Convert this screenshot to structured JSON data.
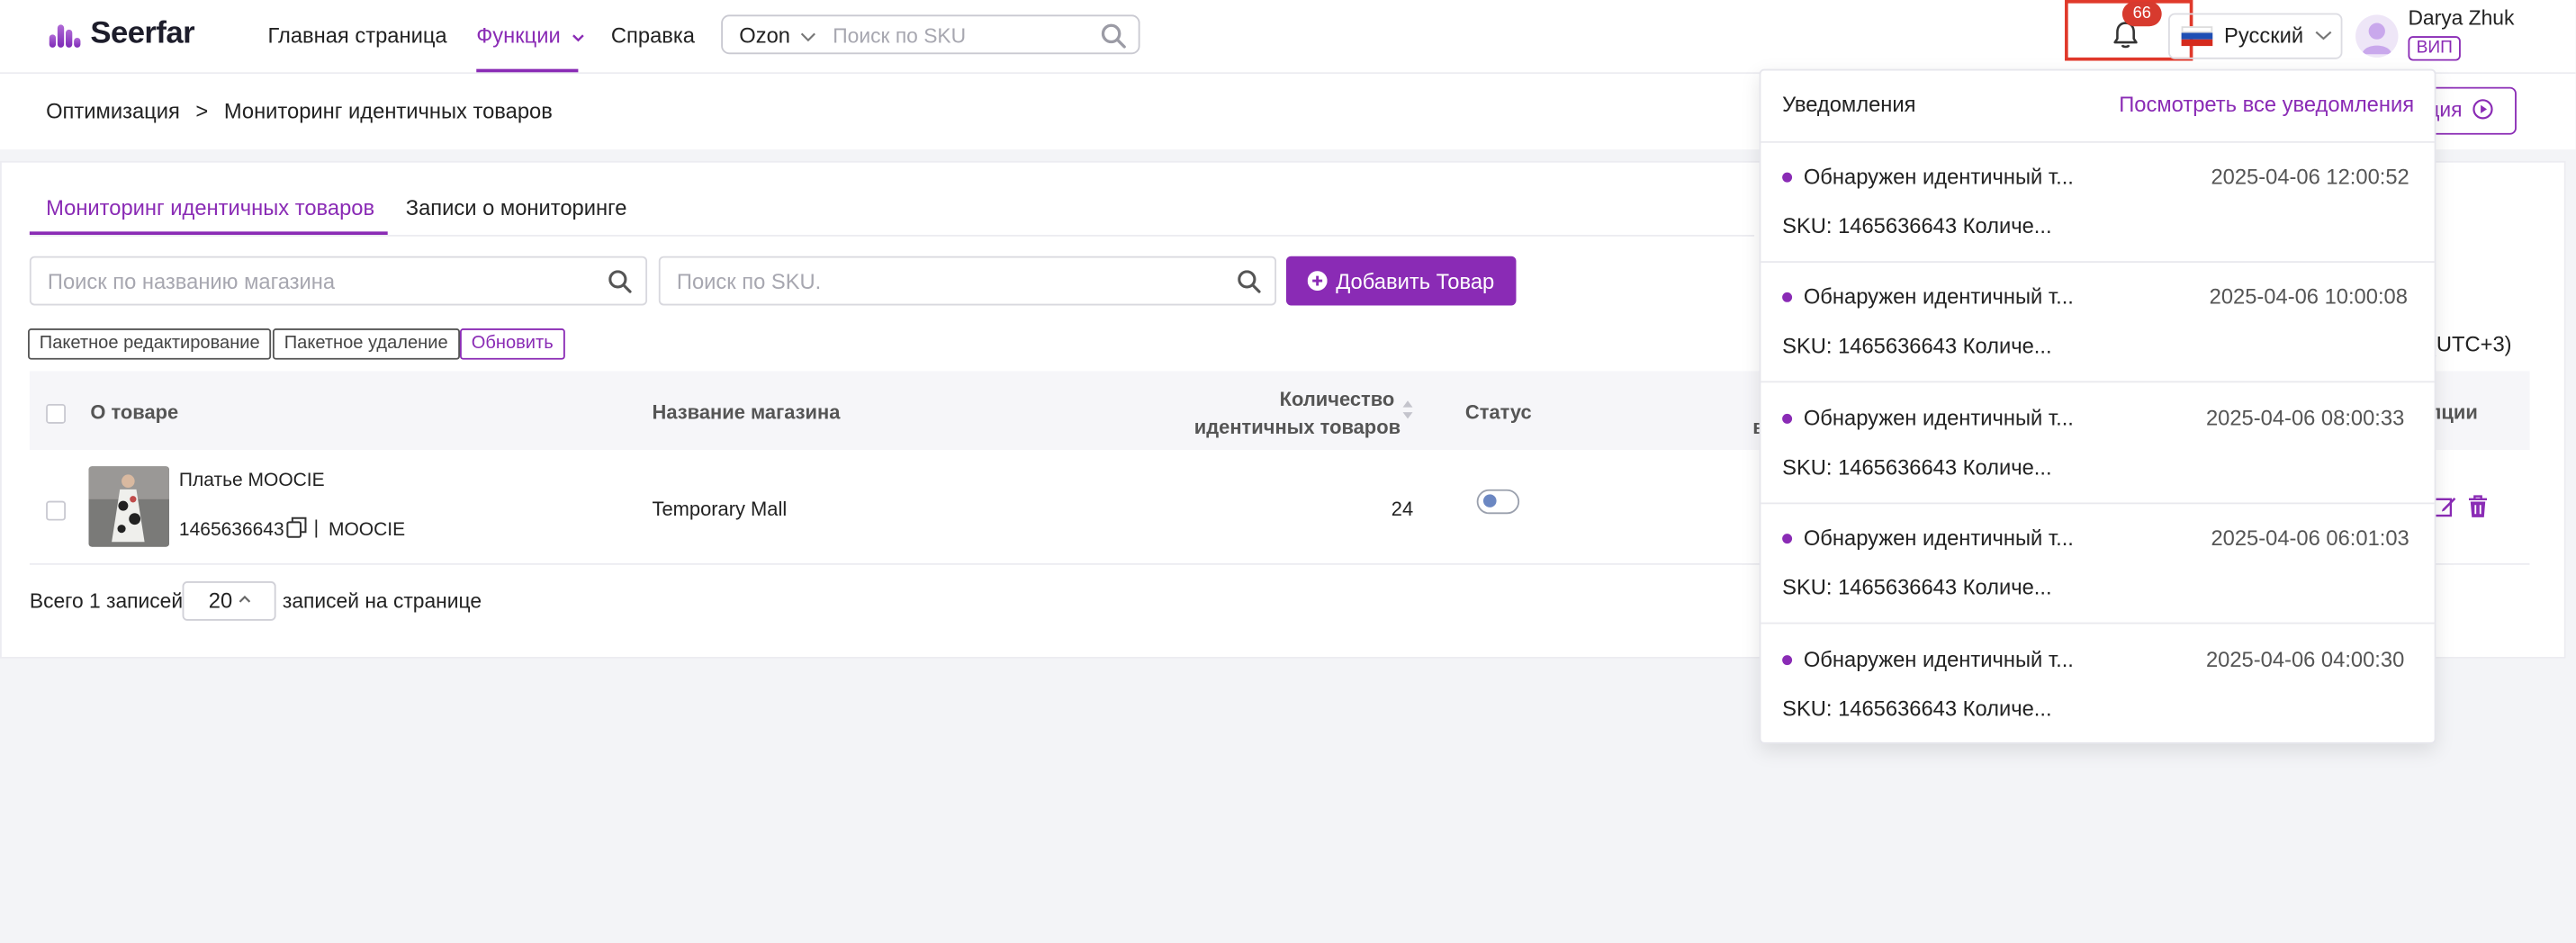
{
  "header": {
    "logo_text": "Seerfar",
    "nav": [
      {
        "label": "Главная страница"
      },
      {
        "label": "Функции"
      },
      {
        "label": "Справка"
      }
    ],
    "search": {
      "platform": "Ozon",
      "placeholder": "Поиск по SKU"
    },
    "notifications_count": "66",
    "language": "Русский",
    "user": {
      "name": "Darya Zhuk",
      "badge": "ВИП"
    }
  },
  "breadcrumb": {
    "root": "Оптимизация",
    "sep": ">",
    "current": "Мониторинг идентичных товаров"
  },
  "instruction_button_partial": "ция",
  "tabs": [
    {
      "label": "Мониторинг идентичных товаров",
      "active": true
    },
    {
      "label": "Записи о мониторинге",
      "active": false
    }
  ],
  "filters": {
    "store_placeholder": "Поиск по названию магазина",
    "sku_placeholder": "Поиск по SKU.",
    "add_button": "Добавить Товар"
  },
  "batch": {
    "edit": "Пакетное редактирование",
    "delete": "Пакетное удаление",
    "refresh": "Обновить"
  },
  "timezone_partial": "и (UTC+3)",
  "table": {
    "headers": {
      "product": "О товаре",
      "store": "Название магазина",
      "count_line1": "Количество",
      "count_line2": "идентичных товаров",
      "status": "Статус",
      "options_partial": "пции",
      "hidden_partial": "в"
    },
    "rows": [
      {
        "title": "Платье MOOCIE",
        "sku": "1465636643",
        "sep": "|",
        "brand": "MOOCIE",
        "store": "Temporary Mall",
        "count": "24",
        "status_on": false
      }
    ]
  },
  "pagination": {
    "total": "Всего 1 записей",
    "page_size": "20",
    "per_page": "записей на странице"
  },
  "notifications": {
    "title": "Уведомления",
    "view_all": "Посмотреть все уведомления",
    "items": [
      {
        "title": "Обнаружен идентичный т...",
        "time": "2025-04-06 12:00:52",
        "body": "SKU: 1465636643 Количе..."
      },
      {
        "title": "Обнаружен идентичный т...",
        "time": "2025-04-06 10:00:08",
        "body": "SKU: 1465636643 Количе..."
      },
      {
        "title": "Обнаружен идентичный т...",
        "time": "2025-04-06 08:00:33",
        "body": "SKU: 1465636643 Количе..."
      },
      {
        "title": "Обнаружен идентичный т...",
        "time": "2025-04-06 06:01:03",
        "body": "SKU: 1465636643 Количе..."
      },
      {
        "title": "Обнаружен идентичный т...",
        "time": "2025-04-06 04:00:30",
        "body": "SKU: 1465636643 Количе..."
      }
    ]
  },
  "colors": {
    "accent": "#8a2bb5",
    "badge": "#d73a2e",
    "highlight_box": "#e0392b"
  }
}
